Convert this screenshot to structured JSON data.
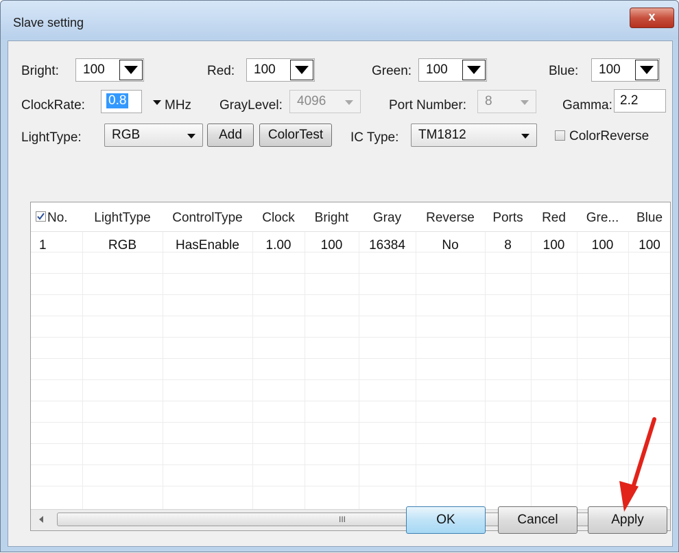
{
  "window": {
    "title": "Slave setting",
    "close_glyph": "x"
  },
  "row1": {
    "bright": {
      "label": "Bright:",
      "value": "100"
    },
    "red": {
      "label": "Red:",
      "value": "100"
    },
    "green": {
      "label": "Green:",
      "value": "100"
    },
    "blue": {
      "label": "Blue:",
      "value": "100"
    }
  },
  "row2": {
    "clockrate": {
      "label": "ClockRate:",
      "value": "0.8",
      "unit": "MHz"
    },
    "graylevel": {
      "label": "GrayLevel:",
      "value": "4096"
    },
    "portnumber": {
      "label": "Port Number:",
      "value": "8"
    },
    "gamma": {
      "label": "Gamma:",
      "value": "2.2"
    }
  },
  "row3": {
    "lighttype": {
      "label": "LightType:",
      "value": "RGB"
    },
    "add_label": "Add",
    "colortest_label": "ColorTest",
    "ictype": {
      "label": "IC Type:",
      "value": "TM1812"
    },
    "colorreverse_label": "ColorReverse"
  },
  "table": {
    "columns": [
      "No.",
      "LightType",
      "ControlType",
      "Clock",
      "Bright",
      "Gray",
      "Reverse",
      "Ports",
      "Red",
      "Gre...",
      "Blue"
    ],
    "rows": [
      [
        "1",
        "RGB",
        "HasEnable",
        "1.00",
        "100",
        "16384",
        "No",
        "8",
        "100",
        "100",
        "100"
      ]
    ],
    "scroll_grip": "III"
  },
  "buttons": {
    "ok": "OK",
    "cancel": "Cancel",
    "apply": "Apply"
  },
  "colors": {
    "annotation_arrow": "#e2231a",
    "title_bar": "#b9d1ec",
    "selected_text_bg": "#3399ff"
  }
}
